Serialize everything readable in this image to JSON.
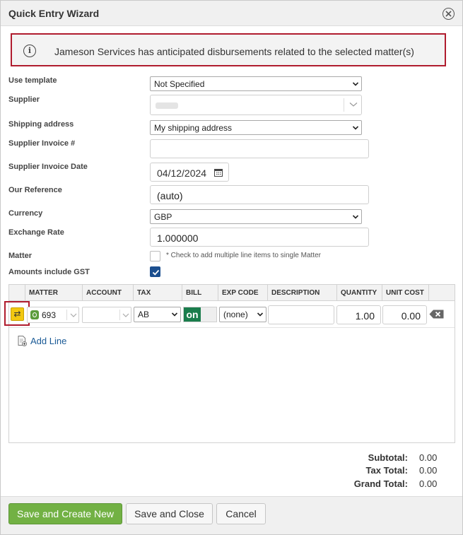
{
  "window": {
    "title": "Quick Entry Wizard"
  },
  "alert": {
    "text": "Jameson Services has anticipated disbursements related to the selected matter(s)"
  },
  "form": {
    "use_template": {
      "label": "Use template",
      "value": "Not Specified"
    },
    "supplier": {
      "label": "Supplier",
      "value": ""
    },
    "shipping_address": {
      "label": "Shipping address",
      "value": "My shipping address"
    },
    "supplier_invoice_no": {
      "label": "Supplier Invoice #",
      "value": ""
    },
    "supplier_invoice_date": {
      "label": "Supplier Invoice Date",
      "value": "04/12/2024"
    },
    "our_reference": {
      "label": "Our Reference",
      "value": "(auto)"
    },
    "currency": {
      "label": "Currency",
      "value": "GBP"
    },
    "exchange_rate": {
      "label": "Exchange Rate",
      "value": "1.000000"
    },
    "matter": {
      "label": "Matter",
      "checked": false,
      "hint": "* Check to add multiple line items to single Matter"
    },
    "amounts_include_gst": {
      "label": "Amounts include GST",
      "checked": true
    }
  },
  "grid": {
    "columns": [
      "MATTER",
      "ACCOUNT",
      "TAX",
      "BILL",
      "EXP CODE",
      "DESCRIPTION",
      "QUANTITY",
      "UNIT COST"
    ],
    "rows": [
      {
        "matter": "693",
        "account": "",
        "tax": "AB",
        "bill": "on",
        "exp_code": "(none)",
        "description": "",
        "quantity": "1.00",
        "unit_cost": "0.00"
      }
    ],
    "add_line": "Add Line"
  },
  "totals": {
    "subtotal_label": "Subtotal:",
    "subtotal": "0.00",
    "tax_total_label": "Tax Total:",
    "tax_total": "0.00",
    "grand_total_label": "Grand Total:",
    "grand_total": "0.00"
  },
  "buttons": {
    "save_new": "Save and Create New",
    "save_close": "Save and Close",
    "cancel": "Cancel"
  },
  "colors": {
    "primary": "#72b144",
    "alert_border": "#b01c2e",
    "checkbox": "#1c4f8f",
    "bill_on": "#1a7d4c",
    "swap": "#f2c811"
  }
}
